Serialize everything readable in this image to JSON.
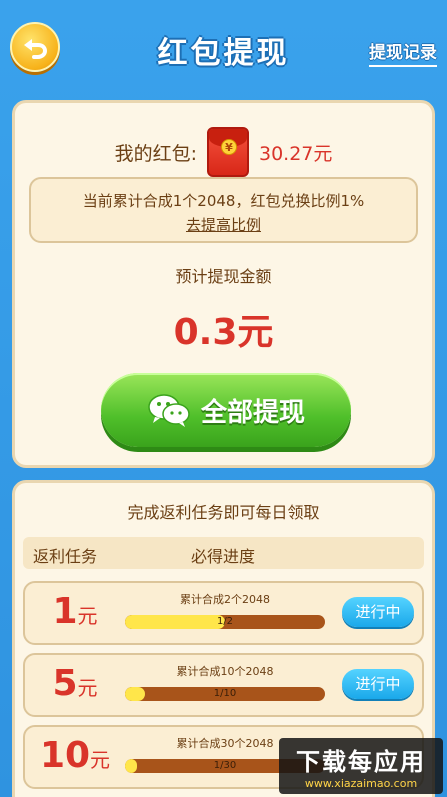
{
  "header": {
    "title": "红包提现",
    "records_label": "提现记录"
  },
  "wallet": {
    "label": "我的红包:",
    "amount": "30.27元"
  },
  "notice": {
    "line1": "当前累计合成1个2048，红包兑换比例1%",
    "link": "去提高比例"
  },
  "estimate": {
    "label": "预计提现金额",
    "amount": "0.3元"
  },
  "withdraw_button": "全部提现",
  "tasks": {
    "header": "完成返利任务即可每日领取",
    "col_task": "返利任务",
    "col_progress": "必得进度",
    "rows": [
      {
        "reward": "1",
        "unit": "元",
        "desc": "累计合成2个2048",
        "progress_text": "1/2",
        "progress": 0.5,
        "status": "进行中"
      },
      {
        "reward": "5",
        "unit": "元",
        "desc": "累计合成10个2048",
        "progress_text": "1/10",
        "progress": 0.1,
        "status": "进行中"
      },
      {
        "reward": "10",
        "unit": "元",
        "desc": "累计合成30个2048",
        "progress_text": "1/30",
        "progress": 0.033,
        "status": ""
      }
    ]
  },
  "watermark": {
    "big": "下载每应用",
    "small": "www.xiazaimao.com"
  }
}
